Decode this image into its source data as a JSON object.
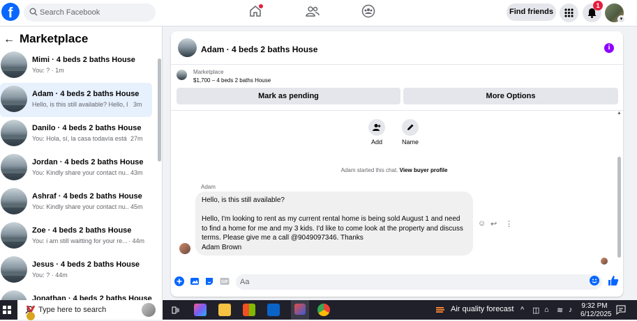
{
  "topbar": {
    "search_placeholder": "Search Facebook",
    "find_friends": "Find friends",
    "notification_count": "1"
  },
  "sidebar": {
    "title": "Marketplace",
    "conversations": [
      {
        "name": "Mimi · 4 beds 2 baths House",
        "preview": "You: ?",
        "time": "· 1m"
      },
      {
        "name": "Adam · 4 beds 2 baths House",
        "preview": "Hello, is this still available? Hello, I'...",
        "time": "3m"
      },
      {
        "name": "Danilo · 4 beds 2 baths House",
        "preview": "You: Hola, sí, la casa todavía está ...",
        "time": "27m"
      },
      {
        "name": "Jordan · 4 beds 2 baths House",
        "preview": "You: Kindly share your contact nu...",
        "time": "43m"
      },
      {
        "name": "Ashraf · 4 beds 2 baths House",
        "preview": "You: Kindly share your contact nu...",
        "time": "45m"
      },
      {
        "name": "Zoe · 4 beds 2 baths House",
        "preview": "You: i am still waitting for your re...",
        "time": "· 44m"
      },
      {
        "name": "Jesus · 4 beds 2 baths House",
        "preview": "You: ?",
        "time": "· 44m"
      },
      {
        "name": "Jonathan · 4 beds 2 baths House",
        "preview": "",
        "time": ""
      }
    ]
  },
  "chat": {
    "title": "Adam · 4 beds 2 baths House",
    "listing_label": "Marketplace",
    "listing_price": "$1,700 – 4 beds 2 baths House",
    "mark_pending": "Mark as pending",
    "more_options": "More Options",
    "add_label": "Add",
    "name_label": "Name",
    "started_text": "Adam started this chat.",
    "view_profile": "View buyer profile",
    "sender": "Adam",
    "message": "Hello, is this still available?\n\nHello, I'm looking to rent as my current rental home is being sold August 1 and need to find a home for me and my 3 kids. I'd like to come look at the property and discuss terms. Please give me a call @9049097346. Thanks\nAdam Brown",
    "input_placeholder": "Aa"
  },
  "taskbar": {
    "search_placeholder": "Type here to search",
    "weather": "Air quality forecast",
    "time": "9:32 PM",
    "date": "6/12/2025"
  },
  "colors": {
    "brand": "#0866ff",
    "notification": "#e41e3f",
    "info": "#8f00ff"
  }
}
